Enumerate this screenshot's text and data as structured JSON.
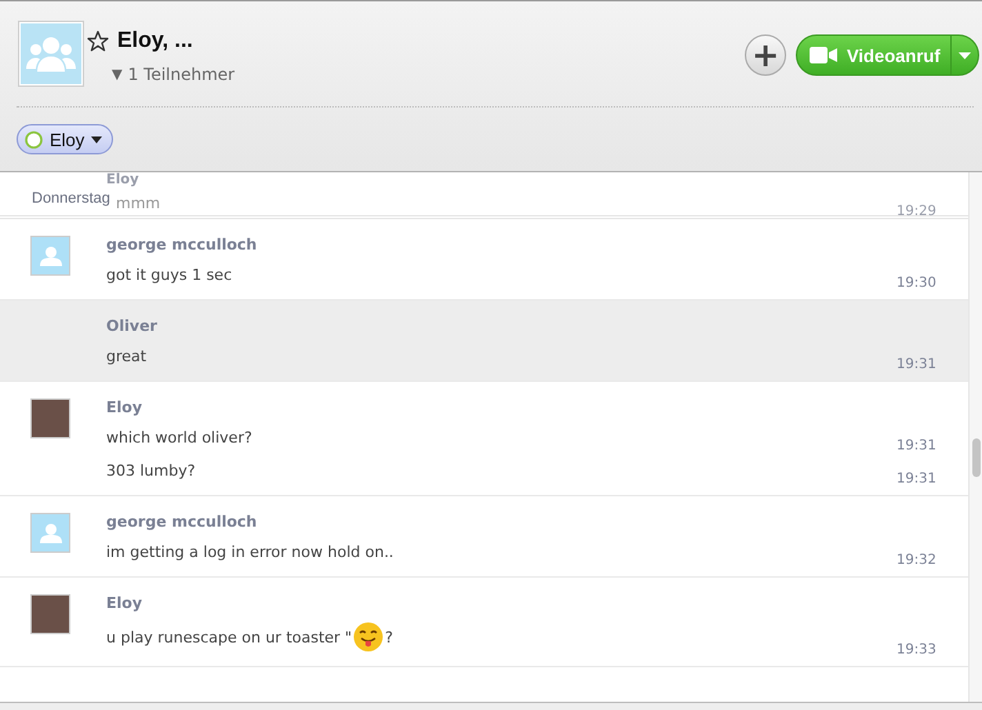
{
  "header": {
    "title": "Eloy, ...",
    "favorite": false,
    "participants_toggle": "▼",
    "participants": "1 Teilnehmer",
    "add_button": "+",
    "video_button": "Videoanruf"
  },
  "participant_chip": {
    "name": "Eloy"
  },
  "day_separator": "Donnerstag",
  "messages": [
    {
      "sender": "Eloy",
      "kind": "photo-avatar",
      "faded": true,
      "highlighted": false,
      "lines": [
        {
          "parts": [
            {
              "kind": "text",
              "text": "mmm"
            }
          ],
          "time": "19:29"
        }
      ]
    },
    {
      "sender": "george mcculloch",
      "kind": "default-avatar",
      "faded": false,
      "highlighted": false,
      "lines": [
        {
          "parts": [
            {
              "kind": "text",
              "text": "got it guys 1 sec"
            }
          ],
          "time": "19:30"
        }
      ]
    },
    {
      "sender": "Oliver",
      "kind": "no-avatar",
      "faded": false,
      "highlighted": true,
      "lines": [
        {
          "parts": [
            {
              "kind": "text",
              "text": "great"
            }
          ],
          "time": "19:31"
        }
      ]
    },
    {
      "sender": "Eloy",
      "kind": "photo-avatar",
      "faded": false,
      "highlighted": false,
      "lines": [
        {
          "parts": [
            {
              "kind": "text",
              "text": "which world oliver?"
            }
          ],
          "time": "19:31"
        },
        {
          "parts": [
            {
              "kind": "text",
              "text": "303 lumby?"
            }
          ],
          "time": "19:31"
        }
      ]
    },
    {
      "sender": "george mcculloch",
      "kind": "default-avatar",
      "faded": false,
      "highlighted": false,
      "lines": [
        {
          "parts": [
            {
              "kind": "text",
              "text": "im getting a log in error now hold on.."
            }
          ],
          "time": "19:32"
        }
      ]
    },
    {
      "sender": "Eloy",
      "kind": "photo-avatar",
      "faded": false,
      "highlighted": false,
      "lines": [
        {
          "parts": [
            {
              "kind": "text",
              "text": "u play runescape on ur toaster \""
            },
            {
              "kind": "emoji"
            },
            {
              "kind": "text",
              "text": "?"
            }
          ],
          "time": "19:33"
        }
      ]
    }
  ]
}
